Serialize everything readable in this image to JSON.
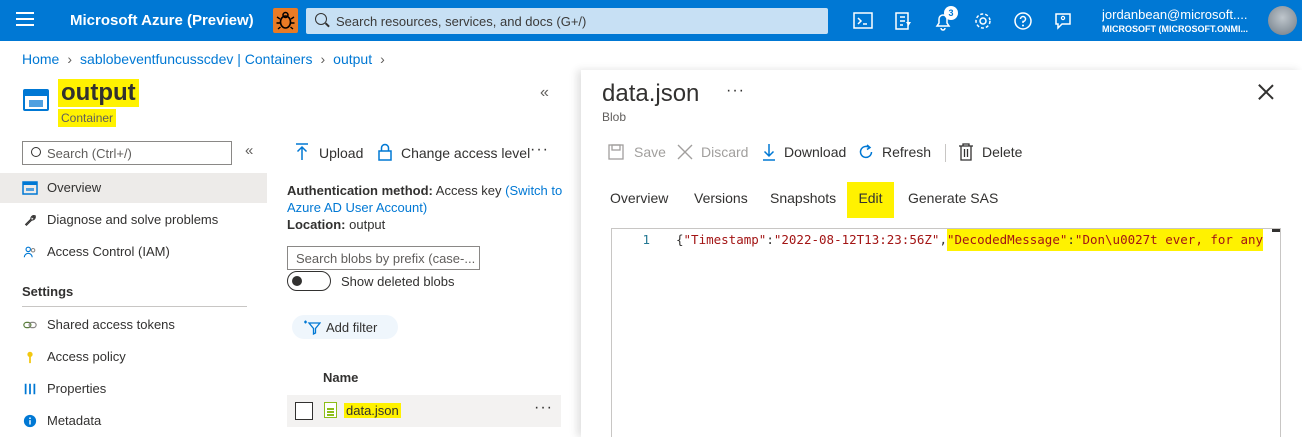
{
  "topbar": {
    "title": "Microsoft Azure (Preview)",
    "search_placeholder": "Search resources, services, and docs (G+/)",
    "notification_count": "3",
    "user_email": "jordanbean@microsoft....",
    "user_tenant": "MICROSOFT (MICROSOFT.ONMI...",
    "accent": "#0078d4"
  },
  "breadcrumb": [
    "Home",
    "sablobeventfuncusscdev | Containers",
    "output"
  ],
  "resource": {
    "title": "output",
    "subtitle": "Container"
  },
  "nav": {
    "search_placeholder": "Search (Ctrl+/)",
    "items": [
      {
        "label": "Overview",
        "icon": "overview-icon"
      },
      {
        "label": "Diagnose and solve problems",
        "icon": "wrench-icon"
      },
      {
        "label": "Access Control (IAM)",
        "icon": "people-icon"
      }
    ],
    "section": "Settings",
    "settings_items": [
      {
        "label": "Shared access tokens",
        "icon": "link-icon"
      },
      {
        "label": "Access policy",
        "icon": "key-icon"
      },
      {
        "label": "Properties",
        "icon": "properties-icon"
      },
      {
        "label": "Metadata",
        "icon": "info-icon"
      }
    ]
  },
  "blobs": {
    "upload_label": "Upload",
    "change_access_label": "Change access level",
    "auth_label": "Authentication method:",
    "auth_value": "Access key",
    "auth_link": "(Switch to Azure AD User Account)",
    "location_label": "Location:",
    "location_value": "output",
    "search_placeholder": "Search blobs by prefix (case-...",
    "show_deleted_label": "Show deleted blobs",
    "add_filter_label": "Add filter",
    "column_name": "Name",
    "rows": [
      {
        "name": "data.json"
      }
    ]
  },
  "blade": {
    "title": "data.json",
    "subtitle": "Blob",
    "toolbar": {
      "save": "Save",
      "discard": "Discard",
      "download": "Download",
      "refresh": "Refresh",
      "delete": "Delete"
    },
    "tabs": [
      "Overview",
      "Versions",
      "Snapshots",
      "Edit",
      "Generate SAS"
    ],
    "active_tab": "Edit",
    "editor": {
      "line_number": "1",
      "open": "{",
      "key1": "\"Timestamp\"",
      "colon1": ":",
      "val1": "\"2022-08-12T13:23:56Z\"",
      "comma1": ",",
      "key2": "\"DecodedMessage\"",
      "colon2": ":",
      "val2": "\"Don\\u0027t ever, for any"
    }
  },
  "highlight_color": "#fff200"
}
